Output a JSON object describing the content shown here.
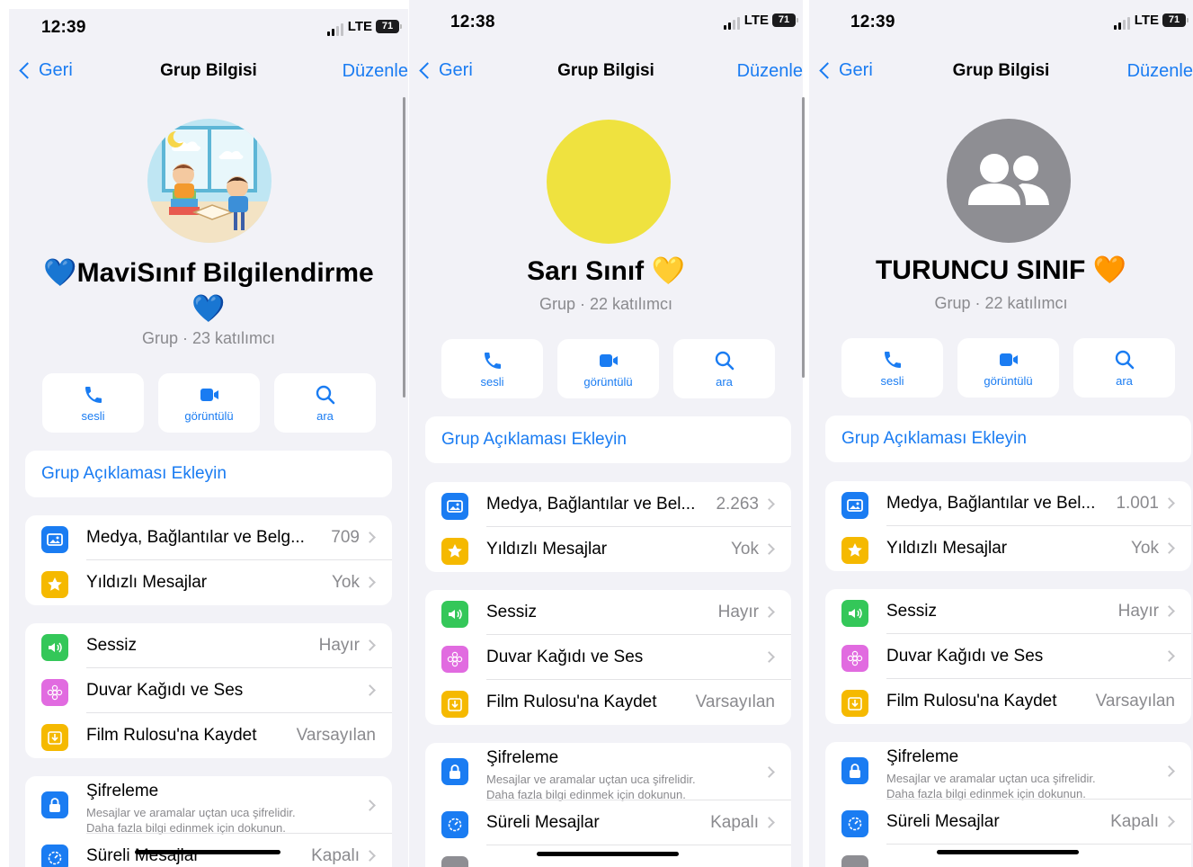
{
  "colors": {
    "accent": "#1a7cf2",
    "blue_icon": "#1a7cf2",
    "yellow_icon": "#f5b900",
    "green_icon": "#34c759",
    "pink_icon": "#e16be0",
    "yellow_avatar": "#efe23f",
    "gray_avatar": "#8e8e93"
  },
  "panels": [
    {
      "status": {
        "time": "12:39",
        "network": "LTE",
        "battery": "71"
      },
      "nav": {
        "back": "Geri",
        "title": "Grup Bilgisi",
        "edit": "Düzenle"
      },
      "avatar": "illustration",
      "name_line1": "💙MaviSınıf Bilgilendirme",
      "name_line2": "💙",
      "subtitle": "Grup · 23 katılımcı",
      "actions": [
        "sesli",
        "görüntülü",
        "ara"
      ],
      "description": "Grup Açıklaması Ekleyin",
      "media": {
        "label": "Medya, Bağlantılar ve Belg...",
        "value": "709"
      },
      "starred": {
        "label": "Yıldızlı Mesajlar",
        "value": "Yok"
      },
      "mute": {
        "label": "Sessiz",
        "value": "Hayır"
      },
      "wallpaper": {
        "label": "Duvar Kağıdı ve Ses"
      },
      "camera_roll": {
        "label": "Film Rulosu'na Kaydet",
        "value": "Varsayılan"
      },
      "encryption": {
        "label": "Şifreleme",
        "line1": "Mesajlar ve aramalar uçtan uca şifrelidir.",
        "line2": "Daha fazla bilgi edinmek için dokunun."
      },
      "disappearing": {
        "label": "Süreli Mesajlar",
        "value": "Kapalı"
      }
    },
    {
      "status": {
        "time": "12:38",
        "network": "LTE",
        "battery": "71"
      },
      "nav": {
        "back": "Geri",
        "title": "Grup Bilgisi",
        "edit": "Düzenle"
      },
      "avatar": "yellow-circle",
      "name_line1": "Sarı Sınıf 💛",
      "subtitle": "Grup · 22 katılımcı",
      "actions": [
        "sesli",
        "görüntülü",
        "ara"
      ],
      "description": "Grup Açıklaması Ekleyin",
      "media": {
        "label": "Medya, Bağlantılar ve Bel...",
        "value": "2.263"
      },
      "starred": {
        "label": "Yıldızlı Mesajlar",
        "value": "Yok"
      },
      "mute": {
        "label": "Sessiz",
        "value": "Hayır"
      },
      "wallpaper": {
        "label": "Duvar Kağıdı ve Ses"
      },
      "camera_roll": {
        "label": "Film Rulosu'na Kaydet",
        "value": "Varsayılan"
      },
      "encryption": {
        "label": "Şifreleme",
        "line1": "Mesajlar ve aramalar uçtan uca şifrelidir.",
        "line2": "Daha fazla bilgi edinmek için dokunun."
      },
      "disappearing": {
        "label": "Süreli Mesajlar",
        "value": "Kapalı"
      }
    },
    {
      "status": {
        "time": "12:39",
        "network": "LTE",
        "battery": "71"
      },
      "nav": {
        "back": "Geri",
        "title": "Grup Bilgisi",
        "edit": "Düzenle"
      },
      "avatar": "default-group",
      "name_line1": "TURUNCU SINIF 🧡",
      "subtitle": "Grup · 22 katılımcı",
      "actions": [
        "sesli",
        "görüntülü",
        "ara"
      ],
      "description": "Grup Açıklaması Ekleyin",
      "media": {
        "label": "Medya, Bağlantılar ve Bel...",
        "value": "1.001"
      },
      "starred": {
        "label": "Yıldızlı Mesajlar",
        "value": "Yok"
      },
      "mute": {
        "label": "Sessiz",
        "value": "Hayır"
      },
      "wallpaper": {
        "label": "Duvar Kağıdı ve Ses"
      },
      "camera_roll": {
        "label": "Film Rulosu'na Kaydet",
        "value": "Varsayılan"
      },
      "encryption": {
        "label": "Şifreleme",
        "line1": "Mesajlar ve aramalar uçtan uca şifrelidir.",
        "line2": "Daha fazla bilgi edinmek için dokunun."
      },
      "disappearing": {
        "label": "Süreli Mesajlar",
        "value": "Kapalı"
      }
    }
  ]
}
